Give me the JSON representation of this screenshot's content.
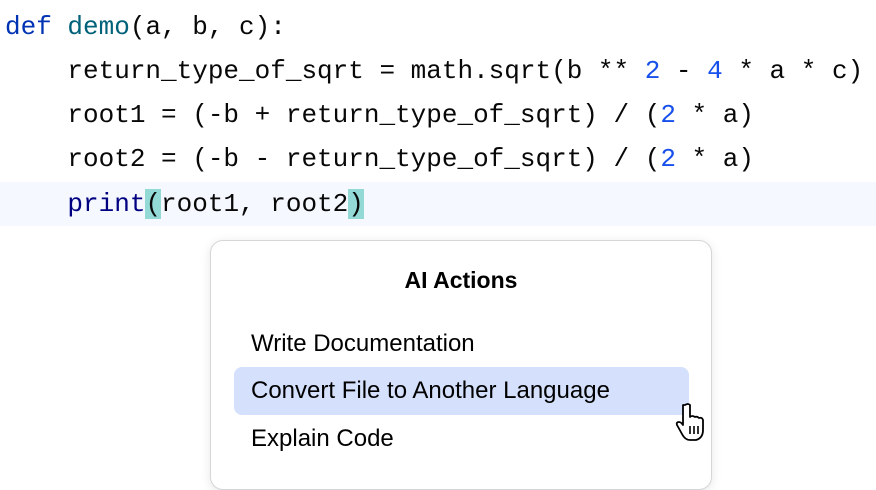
{
  "code": {
    "lines": [
      [
        {
          "t": "def",
          "c": "kw"
        },
        {
          "t": " "
        },
        {
          "t": "demo",
          "c": "fn"
        },
        {
          "t": "(a, b, c):"
        }
      ],
      [
        {
          "t": "    return_type_of_sqrt = math.sqrt(b ** "
        },
        {
          "t": "2",
          "c": "num"
        },
        {
          "t": " - "
        },
        {
          "t": "4",
          "c": "num"
        },
        {
          "t": " * a * c)"
        }
      ],
      [
        {
          "t": "    root1 = (-b + return_type_of_sqrt) / ("
        },
        {
          "t": "2",
          "c": "num"
        },
        {
          "t": " * a)"
        }
      ],
      [
        {
          "t": "    root2 = (-b - return_type_of_sqrt) / ("
        },
        {
          "t": "2",
          "c": "num"
        },
        {
          "t": " * a)"
        }
      ],
      [
        {
          "t": "    "
        },
        {
          "t": "print",
          "c": "builtin"
        },
        {
          "t": "(",
          "c": "brace"
        },
        {
          "t": "root1, root2"
        },
        {
          "t": ")",
          "c": "brace"
        }
      ]
    ],
    "current_line": 4
  },
  "popup": {
    "title": "AI Actions",
    "items": [
      "Write Documentation",
      "Convert File to Another Language",
      "Explain Code"
    ],
    "selected_index": 1
  },
  "colors": {
    "keyword": "#0033b3",
    "function": "#00627a",
    "number": "#1750eb",
    "selection": "#d4e0fc",
    "brace_match": "#93d9d6"
  }
}
